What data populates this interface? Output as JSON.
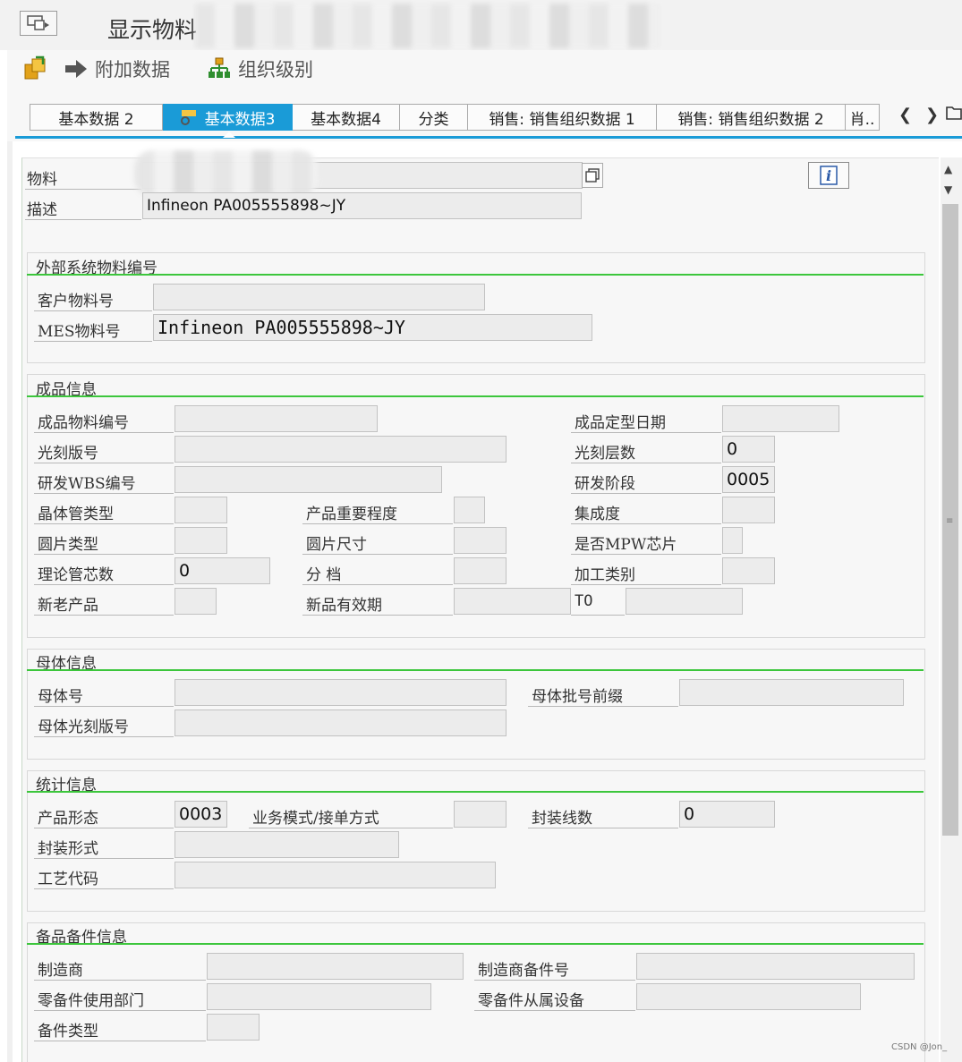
{
  "title": {
    "text": "显示物料"
  },
  "toolbar": {
    "add_data": "附加数据",
    "org_levels": "组织级别"
  },
  "tabs": [
    {
      "label": "基本数据 2"
    },
    {
      "label": "基本数据3"
    },
    {
      "label": "基本数据4"
    },
    {
      "label": "分类"
    },
    {
      "label": "销售: 销售组织数据 1"
    },
    {
      "label": "销售: 销售组织数据 2"
    },
    {
      "label": "肖.."
    }
  ],
  "header": {
    "material_label": "物料",
    "material_value": "",
    "desc_label": "描述",
    "desc_value": "Infineon PA005555898~JY"
  },
  "external": {
    "title": "外部系统物料编号",
    "customer_label": "客户物料号",
    "customer_value": "",
    "mes_label": "MES物料号",
    "mes_value": "Infineon PA005555898~JY"
  },
  "product": {
    "title": "成品信息",
    "code_label": "成品物料编号",
    "code_value": "",
    "date_label": "成品定型日期",
    "date_value": "",
    "litho_label": "光刻版号",
    "litho_value": "",
    "layers_label": "光刻层数",
    "layers_value": "0",
    "wbs_label": "研发WBS编号",
    "wbs_value": "",
    "stage_label": "研发阶段",
    "stage_value": "0005",
    "transistor_label": "晶体管类型",
    "transistor_value": "",
    "importance_label": "产品重要程度",
    "importance_value": "",
    "integration_label": "集成度",
    "integration_value": "",
    "wafer_type_label": "圆片类型",
    "wafer_type_value": "",
    "wafer_size_label": "圆片尺寸",
    "wafer_size_value": "",
    "mpw_label": "是否MPW芯片",
    "mpw_value": "",
    "dies_label": "理论管芯数",
    "dies_value": "0",
    "grade_label": "分 档",
    "grade_value": "",
    "process_label": "加工类别",
    "process_value": "",
    "new_old_label": "新老产品",
    "new_old_value": "",
    "validity_label": "新品有效期",
    "validity_value": "",
    "to_label": "TO",
    "to_value": ""
  },
  "parent": {
    "title": "母体信息",
    "number_label": "母体号",
    "number_value": "",
    "batch_label": "母体批号前缀",
    "batch_value": "",
    "litho_label": "母体光刻版号",
    "litho_value": ""
  },
  "stats": {
    "title": "统计信息",
    "form_label": "产品形态",
    "form_value": "0003",
    "mode_label": "业务模式/接单方式",
    "mode_value": "",
    "wires_label": "封装线数",
    "wires_value": "0",
    "package_label": "封装形式",
    "package_value": "",
    "craft_label": "工艺代码",
    "craft_value": ""
  },
  "spare": {
    "title": "备品备件信息",
    "maker_label": "制造商",
    "maker_value": "",
    "maker_part_label": "制造商备件号",
    "maker_part_value": "",
    "dept_label": "零备件使用部门",
    "dept_value": "",
    "equip_label": "零备件从属设备",
    "equip_value": "",
    "type_label": "备件类型",
    "type_value": ""
  },
  "watermark": "CSDN @Jon_",
  "colors": {
    "accent": "#1a9bd7",
    "group_line": "#3cc63c",
    "field_bg": "#ececec"
  }
}
